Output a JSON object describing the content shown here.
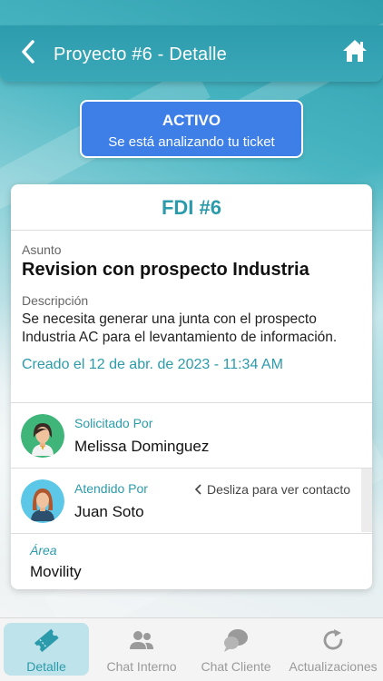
{
  "header": {
    "title": "Proyecto #6 - Detalle"
  },
  "status": {
    "label": "ACTIVO",
    "message": "Se está analizando tu ticket"
  },
  "ticket": {
    "title": "FDI #6",
    "subject_label": "Asunto",
    "subject": "Revision con prospecto Industria",
    "description_label": "Descripción",
    "description": "Se necesita generar una junta con el prospecto Industria AC para el levantamiento de información.",
    "created": "Creado el 12 de abr. de 2023 - 11:34 AM"
  },
  "requested": {
    "role": "Solicitado Por",
    "name": "Melissa Dominguez"
  },
  "attended": {
    "role": "Atendido Por",
    "name": "Juan Soto",
    "hint": "Desliza para ver contacto"
  },
  "area": {
    "label": "Área",
    "value": "Movility"
  },
  "tabs": [
    {
      "label": "Detalle",
      "icon": "ticket-icon",
      "active": true
    },
    {
      "label": "Chat Interno",
      "icon": "people-icon",
      "active": false
    },
    {
      "label": "Chat Cliente",
      "icon": "chat-bubbles-icon",
      "active": false
    },
    {
      "label": "Actualizaciones",
      "icon": "refresh-icon",
      "active": false
    }
  ],
  "colors": {
    "accent": "#2b9bab",
    "status_blue": "#3d7fe6",
    "active_tab_bg": "#bfe3ea"
  }
}
